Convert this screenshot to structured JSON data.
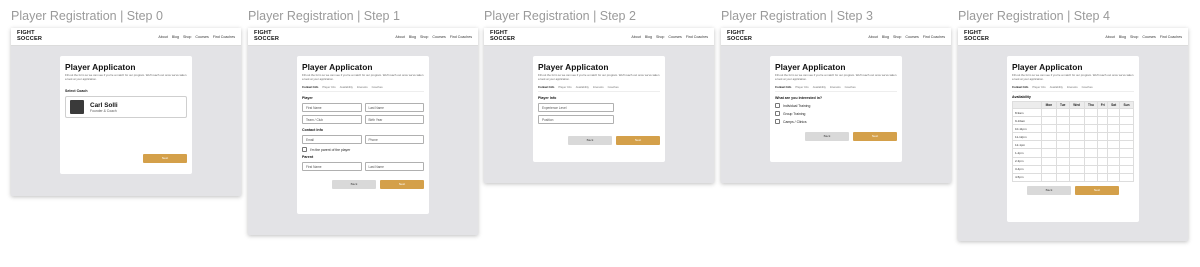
{
  "brand": {
    "logo_line1": "FIGHT",
    "logo_line2": "SOCCER"
  },
  "nav_links": [
    "About",
    "Blog",
    "Shop",
    "Courses",
    "Find Coaches"
  ],
  "app_title": "Player Applicaton",
  "intro": "Fill out the form so we can see if you're a match for our program. We'll reach out once we've taken a look at your application.",
  "steps": [
    "Contact Info",
    "Player Info",
    "Availability",
    "Interests",
    "Coaches"
  ],
  "buttons": {
    "back": "Back",
    "next": "Next"
  },
  "frames": [
    {
      "title": "Player Registration | Step 0"
    },
    {
      "title": "Player Registration | Step 1"
    },
    {
      "title": "Player Registration | Step 2"
    },
    {
      "title": "Player Registration | Step 3"
    },
    {
      "title": "Player Registration | Step 4"
    }
  ],
  "step0": {
    "section": "Select Coach",
    "coach_name": "Carl Solli",
    "coach_role": "Founder & Coach"
  },
  "step1": {
    "player_section": "Player",
    "first_name": "First Name",
    "last_name": "Last Name",
    "team_club": "Team / Club",
    "birth_year": "Birth Year",
    "contact_section": "Contact Info",
    "email": "Email",
    "phone": "Phone",
    "parent_checkbox": "I'm the parent of the player",
    "parent_section": "Parent",
    "parent_first_name": "First Name",
    "parent_last_name": "Last Name"
  },
  "step2": {
    "section": "Player Info",
    "experience": "Experience Level",
    "position": "Position"
  },
  "step3": {
    "question": "What are you interested in?",
    "options": [
      "Individual Training",
      "Group Training",
      "Camps / Clinics"
    ]
  },
  "step4": {
    "section": "Availability",
    "days": [
      "Mon",
      "Tue",
      "Wed",
      "Thu",
      "Fri",
      "Sat",
      "Sun"
    ],
    "times": [
      "8-9am",
      "9-10am",
      "10-11pm",
      "11-12pm",
      "12-1pm",
      "1-2pm",
      "2-3pm",
      "3-4pm",
      "4-5pm"
    ]
  }
}
